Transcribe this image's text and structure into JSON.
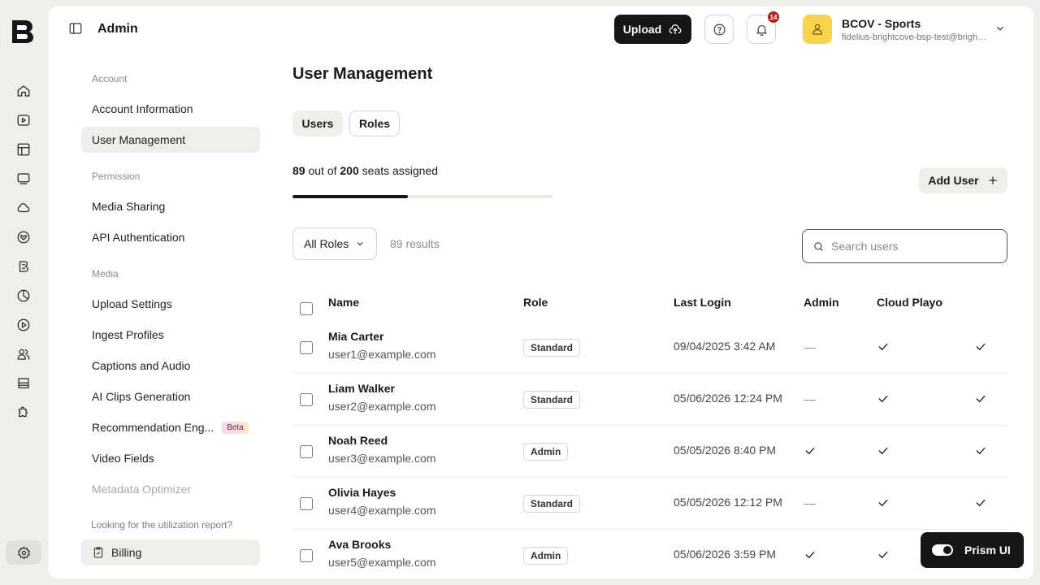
{
  "header": {
    "title": "Admin",
    "upload_label": "Upload",
    "notifications_count": "14",
    "account_name": "BCOV - Sports",
    "account_email": "fidelius-brightcove-bsp-test@brightcove.com"
  },
  "rail": {
    "icons": [
      "home-icon",
      "video-icon",
      "layout-icon",
      "monitor-icon",
      "cloud-icon",
      "heart-icon",
      "brand-icon",
      "analytics-icon",
      "play-icon",
      "users-icon",
      "storage-icon",
      "plugin-icon",
      "settings-icon"
    ]
  },
  "nav": {
    "sections": {
      "account": "Account",
      "permission": "Permission",
      "media": "Media"
    },
    "items": {
      "account_information": "Account Information",
      "user_management": "User Management",
      "media_sharing": "Media Sharing",
      "api_authentication": "API Authentication",
      "upload_settings": "Upload Settings",
      "ingest_profiles": "Ingest Profiles",
      "captions_audio": "Captions and Audio",
      "ai_clips": "AI Clips Generation",
      "recommendation": "Recommendation Eng...",
      "recommendation_badge": "Beta",
      "video_fields": "Video Fields",
      "metadata_optimizer": "Metadata Optimizer"
    },
    "hint": "Looking for the utilization report?",
    "billing": "Billing"
  },
  "main": {
    "title": "User Management",
    "tabs": [
      "Users",
      "Roles"
    ],
    "seats": {
      "assigned": "89",
      "out_of": "out of",
      "total": "200",
      "suffix": "seats assigned",
      "fraction": 0.445
    },
    "add_user": "Add User",
    "filter": {
      "selected": "All Roles",
      "results": "89 results"
    },
    "search": {
      "placeholder": "Search users",
      "value": ""
    },
    "columns": [
      "Name",
      "Role",
      "Last Login",
      "Admin",
      "Cloud Playout"
    ],
    "rows": [
      {
        "name": "Mia Carter",
        "email": "user1@example.com",
        "role": "Standard",
        "last_login": "09/04/2025 3:42 AM",
        "admin": false,
        "cloud_playout": true,
        "extra": true
      },
      {
        "name": "Liam Walker",
        "email": "user2@example.com",
        "role": "Standard",
        "last_login": "05/06/2026 12:24 PM",
        "admin": false,
        "cloud_playout": true,
        "extra": true
      },
      {
        "name": "Noah Reed",
        "email": "user3@example.com",
        "role": "Admin",
        "last_login": "05/05/2026 8:40 PM",
        "admin": true,
        "cloud_playout": true,
        "extra": true
      },
      {
        "name": "Olivia Hayes",
        "email": "user4@example.com",
        "role": "Standard",
        "last_login": "05/05/2026 12:12 PM",
        "admin": false,
        "cloud_playout": true,
        "extra": true
      },
      {
        "name": "Ava Brooks",
        "email": "user5@example.com",
        "role": "Admin",
        "last_login": "05/06/2026 3:59 PM",
        "admin": true,
        "cloud_playout": true,
        "extra": false
      }
    ]
  },
  "prism": {
    "label": "Prism UI",
    "enabled": true
  }
}
